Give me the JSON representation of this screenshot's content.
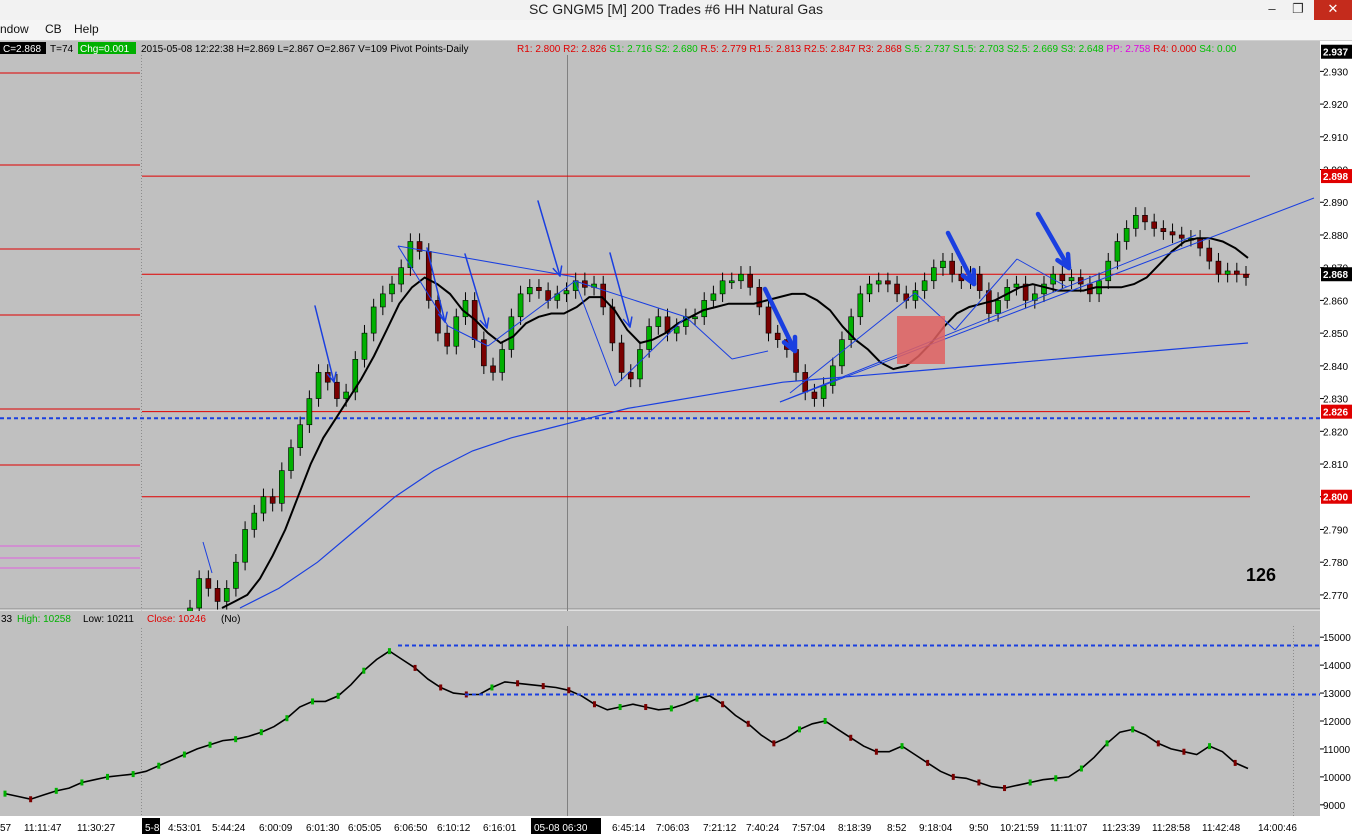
{
  "window": {
    "title": "SC GNGM5 [M]  200 Trades  #6  HH Natural Gas",
    "minimize": "–",
    "restore": "❐",
    "close": "✕"
  },
  "menu": [
    "ndow",
    "CB",
    "Help"
  ],
  "info_bar": {
    "last": "C=2.868",
    "trades": "T=74",
    "chg": "Chg=0.001",
    "ohlc": "2015-05-08 12:22:38 H=2.869 L=2.867 O=2.867 V=109 Pivot Points-Daily",
    "pivots": [
      {
        "text": "R1: 2.800",
        "color": "#e00000"
      },
      {
        "text": "R2: 2.826",
        "color": "#e00000"
      },
      {
        "text": "S1: 2.716",
        "color": "#00c000"
      },
      {
        "text": "S2: 2.680",
        "color": "#00c000"
      },
      {
        "text": "R.5: 2.779",
        "color": "#e00000"
      },
      {
        "text": "R1.5: 2.813",
        "color": "#e00000"
      },
      {
        "text": "R2.5: 2.847",
        "color": "#e00000"
      },
      {
        "text": "R3: 2.868",
        "color": "#e00000"
      },
      {
        "text": "S.5: 2.737",
        "color": "#00c000"
      },
      {
        "text": "S1.5: 2.703",
        "color": "#00c000"
      },
      {
        "text": "S2.5: 2.669",
        "color": "#00c000"
      },
      {
        "text": "S3: 2.648",
        "color": "#00c000"
      },
      {
        "text": "PP: 2.758",
        "color": "#e000e0"
      },
      {
        "text": "R4: 0.000",
        "color": "#e00000"
      },
      {
        "text": "S4: 0.00",
        "color": "#00c000"
      }
    ]
  },
  "lower_info": {
    "prefix": "33",
    "high": "High: 10258",
    "low": "Low: 10211",
    "close": "Close: 10246",
    "tag": "(No)"
  },
  "bar_counter": "126",
  "colors": {
    "bull": "#00b000",
    "bear": "#7a0000",
    "pivot": "#e00000",
    "trendline": "#1a3fe0",
    "ema_fast": "#000000",
    "ema_slow": "#1a3fe0",
    "highlight_box": "#e06060"
  },
  "chart_data": [
    {
      "type": "candlestick",
      "title": "SC GNGM5 [M]  200 Trades  #6  HH Natural Gas",
      "x_tick_labels": [
        "57",
        "11:11:47",
        "11:30:27",
        "5-8",
        "4:53:01",
        "5:44:24",
        "6:00:09",
        "6:01:30",
        "6:05:05",
        "6:06:50",
        "6:10:12",
        "6:16:01",
        "05-08  06:30",
        "6:45:14",
        "7:06:03",
        "7:21:12",
        "7:40:24",
        "7:57:04",
        "8:18:39",
        "8:52",
        "9:18:04",
        "9:50",
        "10:21:59",
        "11:11:07",
        "11:23:39",
        "11:28:58",
        "11:42:48",
        "14:00:46"
      ],
      "y_ticks": [
        2.77,
        2.78,
        2.79,
        2.8,
        2.81,
        2.82,
        2.83,
        2.84,
        2.85,
        2.86,
        2.87,
        2.88,
        2.89,
        2.9,
        2.91,
        2.92,
        2.93
      ],
      "y_tick_labels": [
        "2.770",
        "2.780",
        "2.790",
        "2.800",
        "2.810",
        "2.820",
        "2.830",
        "2.840",
        "2.850",
        "2.860",
        "2.870",
        "2.880",
        "2.890",
        "2.900",
        "2.910",
        "2.920",
        "2.930"
      ],
      "ylim": [
        2.766,
        2.935
      ],
      "price_tags": [
        {
          "label": "2.937",
          "value": 2.936,
          "bg": "#000000",
          "fg": "#ffffff"
        },
        {
          "label": "2.898",
          "value": 2.898,
          "bg": "#e00000",
          "fg": "#ffffff"
        },
        {
          "label": "2.868",
          "value": 2.868,
          "bg": "#000000",
          "fg": "#ffffff"
        },
        {
          "label": "2.826",
          "value": 2.826,
          "bg": "#e00000",
          "fg": "#ffffff"
        },
        {
          "label": "2.800",
          "value": 2.8,
          "bg": "#e00000",
          "fg": "#ffffff"
        }
      ],
      "pivot_lines": [
        2.898,
        2.868,
        2.826,
        2.8
      ],
      "dashed_level": 2.824,
      "series": [
        {
          "name": "close",
          "values": [
            2.766,
            2.775,
            2.772,
            2.768,
            2.772,
            2.78,
            2.79,
            2.795,
            2.8,
            2.798,
            2.808,
            2.815,
            2.822,
            2.83,
            2.838,
            2.835,
            2.83,
            2.832,
            2.842,
            2.85,
            2.858,
            2.862,
            2.865,
            2.87,
            2.878,
            2.875,
            2.86,
            2.85,
            2.846,
            2.855,
            2.86,
            2.848,
            2.84,
            2.838,
            2.845,
            2.855,
            2.862,
            2.864,
            2.863,
            2.86,
            2.862,
            2.863,
            2.866,
            2.864,
            2.865,
            2.858,
            2.847,
            2.838,
            2.836,
            2.845,
            2.852,
            2.855,
            2.85,
            2.852,
            2.855,
            2.855,
            2.86,
            2.862,
            2.866,
            2.866,
            2.868,
            2.864,
            2.858,
            2.85,
            2.848,
            2.845,
            2.838,
            2.832,
            2.83,
            2.834,
            2.84,
            2.848,
            2.855,
            2.862,
            2.865,
            2.866,
            2.865,
            2.862,
            2.86,
            2.863,
            2.866,
            2.87,
            2.872,
            2.868,
            2.866,
            2.868,
            2.863,
            2.856,
            2.86,
            2.864,
            2.865,
            2.86,
            2.862,
            2.865,
            2.868,
            2.866,
            2.867,
            2.865,
            2.862,
            2.866,
            2.872,
            2.878,
            2.882,
            2.886,
            2.884,
            2.882,
            2.881,
            2.88,
            2.879,
            2.879,
            2.876,
            2.872,
            2.868,
            2.869,
            2.868,
            2.867
          ]
        },
        {
          "name": "ema_fast",
          "values": [
            2.766,
            2.768,
            2.77,
            2.775,
            2.782,
            2.79,
            2.8,
            2.81,
            2.818,
            2.824,
            2.83,
            2.836,
            2.843,
            2.851,
            2.859,
            2.864,
            2.867,
            2.865,
            2.862,
            2.857,
            2.854,
            2.85,
            2.847,
            2.849,
            2.853,
            2.855,
            2.856,
            2.856,
            2.858,
            2.861,
            2.861,
            2.857,
            2.851,
            2.847,
            2.848,
            2.85,
            2.853,
            2.855,
            2.857,
            2.858,
            2.859,
            2.859,
            2.859,
            2.86,
            2.861,
            2.862,
            2.862,
            2.86,
            2.857,
            2.852,
            2.848,
            2.845,
            2.841,
            2.839,
            2.84,
            2.843,
            2.847,
            2.852,
            2.856,
            2.858,
            2.859,
            2.86,
            2.862,
            2.864,
            2.865,
            2.864,
            2.863,
            2.863,
            2.863,
            2.864,
            2.864,
            2.864,
            2.865,
            2.867,
            2.871,
            2.875,
            2.878,
            2.879,
            2.879,
            2.878,
            2.876,
            2.873
          ]
        },
        {
          "name": "ema_slow",
          "values": [
            2.766,
            2.772,
            2.78,
            2.79,
            2.8,
            2.808,
            2.814,
            2.818,
            2.821,
            2.824,
            2.827,
            2.829,
            2.831,
            2.833,
            2.835,
            2.836,
            2.837,
            2.838,
            2.839,
            2.84,
            2.841,
            2.842,
            2.843,
            2.844,
            2.845,
            2.846,
            2.847
          ]
        }
      ]
    },
    {
      "type": "line",
      "y_ticks": [
        9000,
        10000,
        11000,
        12000,
        13000,
        14000,
        15000
      ],
      "y_tick_labels": [
        "9000",
        "10000",
        "11000",
        "12000",
        "13000",
        "14000",
        "15000"
      ],
      "ylim": [
        8600,
        15400
      ],
      "dashed_levels": [
        14700,
        12950
      ],
      "series": [
        {
          "name": "",
          "values": [
            9400,
            9300,
            9200,
            9350,
            9500,
            9600,
            9800,
            9900,
            10000,
            10050,
            10100,
            10200,
            10400,
            10600,
            10800,
            11000,
            11150,
            11300,
            11350,
            11450,
            11600,
            11800,
            12100,
            12500,
            12700,
            12700,
            12900,
            13300,
            13800,
            14200,
            14500,
            14200,
            13900,
            13500,
            13200,
            13000,
            12950,
            12950,
            13200,
            13400,
            13350,
            13300,
            13250,
            13200,
            13100,
            12900,
            12600,
            12400,
            12500,
            12600,
            12500,
            12400,
            12450,
            12600,
            12800,
            12900,
            12600,
            12200,
            11900,
            11500,
            11200,
            11400,
            11700,
            11900,
            12000,
            11700,
            11400,
            11100,
            10900,
            10900,
            11100,
            10800,
            10500,
            10200,
            10000,
            9950,
            9800,
            9650,
            9600,
            9700,
            9800,
            9900,
            9950,
            10000,
            10300,
            10700,
            11200,
            11600,
            11700,
            11500,
            11200,
            11000,
            10900,
            10800,
            11100,
            10900,
            10500,
            10300
          ]
        }
      ]
    }
  ]
}
